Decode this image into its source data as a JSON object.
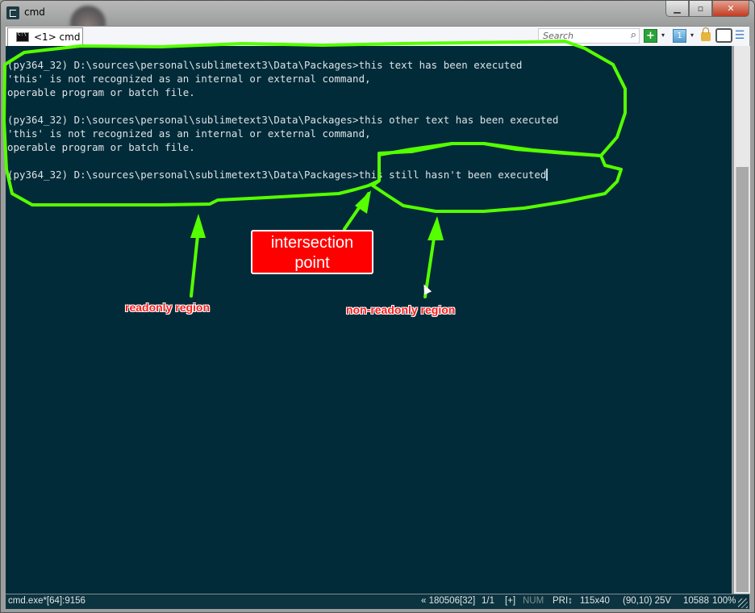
{
  "window": {
    "title": "cmd",
    "controls": {
      "minimize": "▁",
      "maximize": "▫",
      "close": "✕"
    }
  },
  "tabs": [
    {
      "label": "<1> cmd",
      "icon": "console-icon",
      "active": true
    }
  ],
  "toolbar": {
    "search_placeholder": "Search",
    "search_icon": "⌕",
    "new_console_icon": "+",
    "dropdown_glyph": "▾",
    "tab_number": "1",
    "menu_glyph": "☰"
  },
  "console": {
    "lines": [
      "(py364_32) D:\\sources\\personal\\sublimetext3\\Data\\Packages>this text has been executed",
      "'this' is not recognized as an internal or external command,",
      "operable program or batch file.",
      "",
      "(py364_32) D:\\sources\\personal\\sublimetext3\\Data\\Packages>this other text has been executed",
      "'this' is not recognized as an internal or external command,",
      "operable program or batch file.",
      "",
      "(py364_32) D:\\sources\\personal\\sublimetext3\\Data\\Packages>this still hasn't been executed"
    ],
    "background": "#022b3a",
    "text_color": "#dde3e5"
  },
  "annotations": {
    "intersection_label_line1": "intersection",
    "intersection_label_line2": "point",
    "readonly_label": "readonly region",
    "non_readonly_label": "non-readonly region",
    "highlight_color": "#55ff00",
    "label_color": "#ff0000"
  },
  "statusbar": {
    "process": "cmd.exe*[64]:9156",
    "server": "« 180506[32]",
    "console_index": "1/1",
    "plus": "[+]",
    "num": "NUM",
    "pri": "PRI↕",
    "size": "115x40",
    "cursor": "(90,10) 25V",
    "buffer": "10588",
    "zoom": "100%"
  }
}
